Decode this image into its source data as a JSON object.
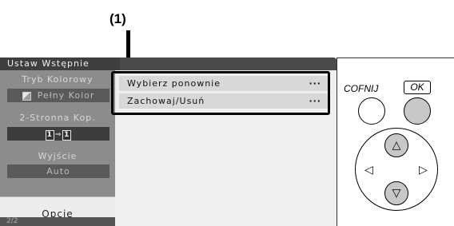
{
  "callout": {
    "label": "(1)"
  },
  "screen": {
    "title": "Ustaw Wstępnie",
    "left_panel": {
      "color_mode": {
        "label": "Tryb Kolorowy",
        "value": "Pełny Kolor"
      },
      "duplex": {
        "label": "2-Stronna Kop.",
        "icon_left": "1",
        "icon_right": "1"
      },
      "output": {
        "label": "Wyjście",
        "value": "Auto"
      },
      "options_label": "Opcje",
      "page_indicator": "2/2"
    },
    "menu": [
      {
        "label": "Wybierz ponownie",
        "suffix": "···"
      },
      {
        "label": "Zachowaj/Usuń",
        "suffix": "···"
      }
    ]
  },
  "control_panel": {
    "back_label": "COFNIJ",
    "ok_label": "OK",
    "arrows": {
      "up": "△",
      "down": "▽",
      "left": "◁",
      "right": "▷"
    }
  },
  "colors": {
    "screen_dark": "#555555",
    "left_panel": "#8c8c8c",
    "content_bg": "#efefef",
    "menu_item": "#d8d8d8",
    "button_gray": "#c8c8c8"
  }
}
